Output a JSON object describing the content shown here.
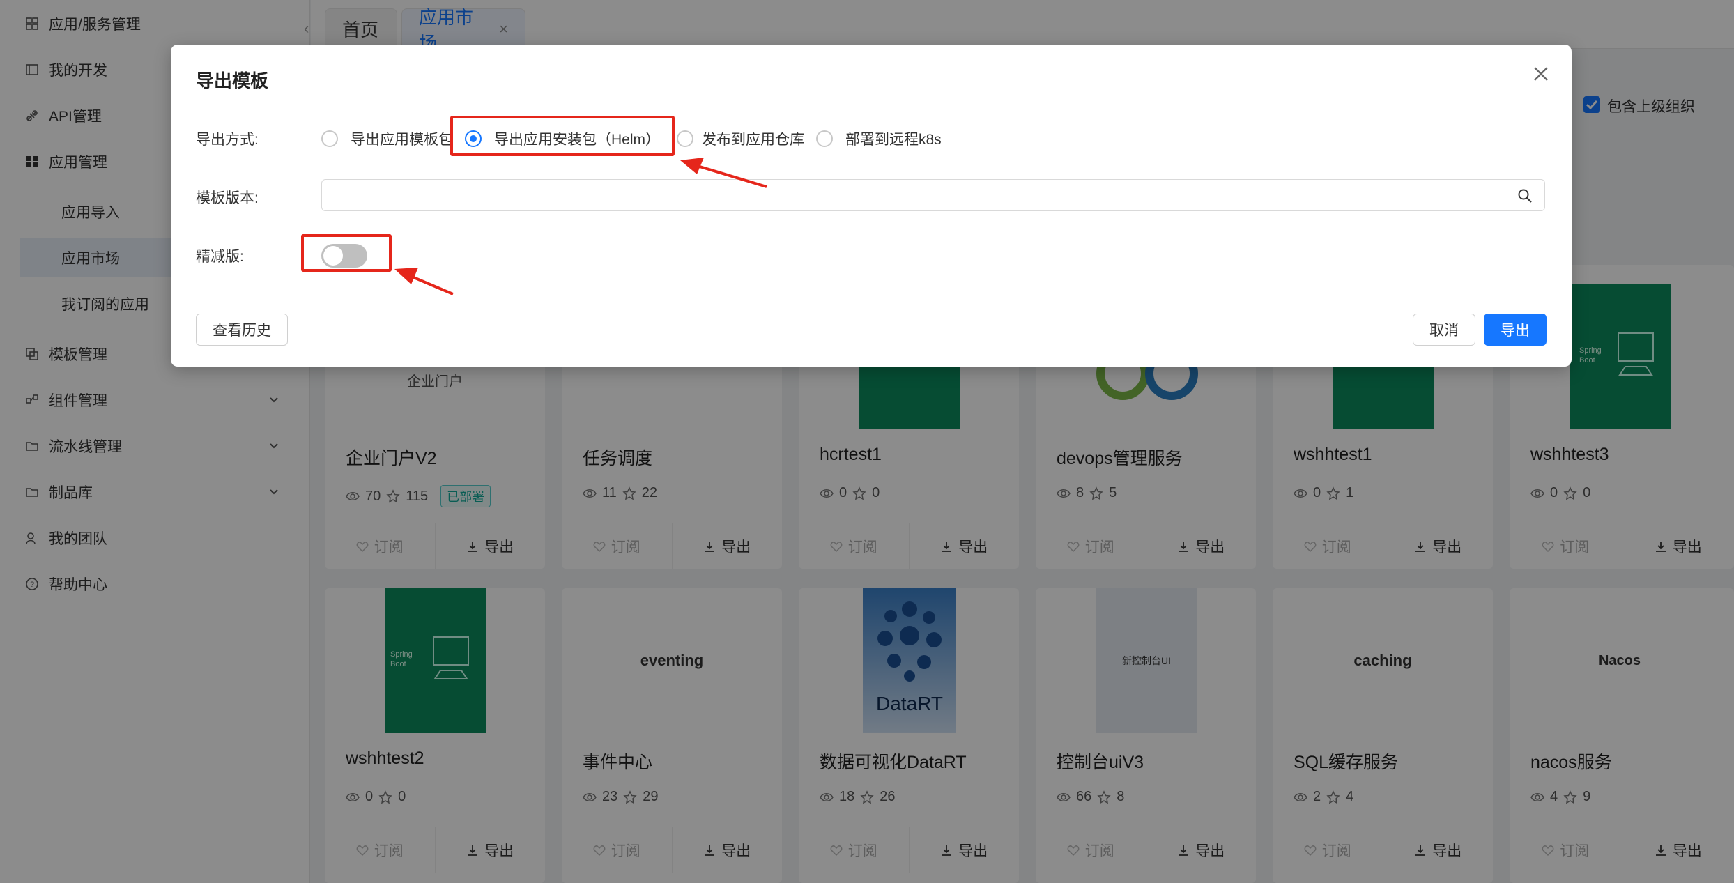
{
  "sidebar": {
    "items": [
      {
        "label": "应用/服务管理",
        "icon": "app-service-icon"
      },
      {
        "label": "我的开发",
        "icon": "develop-icon"
      },
      {
        "label": "API管理",
        "icon": "api-icon"
      },
      {
        "label": "应用管理",
        "icon": "grid-icon"
      },
      {
        "label": "应用导入"
      },
      {
        "label": "应用市场"
      },
      {
        "label": "我订阅的应用"
      },
      {
        "label": "模板管理",
        "icon": "template-icon"
      },
      {
        "label": "组件管理",
        "icon": "component-icon"
      },
      {
        "label": "流水线管理",
        "icon": "folder-icon"
      },
      {
        "label": "制品库",
        "icon": "folder-icon"
      },
      {
        "label": "我的团队",
        "icon": "team-icon"
      },
      {
        "label": "帮助中心",
        "icon": "help-icon"
      }
    ]
  },
  "tabs": [
    {
      "label": "首页"
    },
    {
      "label": "应用市场",
      "close": "×"
    }
  ],
  "filter": {
    "include_parent_org": "包含上级组织"
  },
  "cards": [
    {
      "title": "企业门户V2",
      "thumb_text": "企业门户",
      "views": "70",
      "stars": "115",
      "badge": "已部署"
    },
    {
      "title": "任务调度",
      "views": "11",
      "stars": "22"
    },
    {
      "title": "hcrtest1",
      "views": "0",
      "stars": "0"
    },
    {
      "title": "devops管理服务",
      "views": "8",
      "stars": "5"
    },
    {
      "title": "wshhtest1",
      "views": "0",
      "stars": "1"
    },
    {
      "title": "wshhtest3",
      "views": "0",
      "stars": "0"
    },
    {
      "title": "wshhtest2",
      "views": "0",
      "stars": "0"
    },
    {
      "title": "事件中心",
      "thumb_text": "eventing",
      "views": "23",
      "stars": "29"
    },
    {
      "title": "数据可视化DataRT",
      "thumb_text": "DataRT",
      "views": "18",
      "stars": "26"
    },
    {
      "title": "控制台uiV3",
      "thumb_text": "新控制台UI",
      "views": "66",
      "stars": "8"
    },
    {
      "title": "SQL缓存服务",
      "thumb_text": "caching",
      "views": "2",
      "stars": "4"
    },
    {
      "title": "nacos服务",
      "thumb_text": "Nacos",
      "views": "4",
      "stars": "9"
    }
  ],
  "card_actions": {
    "subscribe": "订阅",
    "export": "导出"
  },
  "spring_logo": {
    "line1": "Spring",
    "line2": "Boot"
  },
  "modal": {
    "title": "导出模板",
    "export_mode_label": "导出方式:",
    "options": [
      {
        "label": "导出应用模板包",
        "checked": false
      },
      {
        "label": "导出应用安装包（Helm）",
        "checked": true
      },
      {
        "label": "发布到应用仓库",
        "checked": false
      },
      {
        "label": "部署到远程k8s",
        "checked": false
      }
    ],
    "version_label": "模板版本:",
    "version_value": "",
    "lite_label": "精减版:",
    "lite_enabled": false,
    "history_button": "查看历史",
    "cancel_button": "取消",
    "export_button": "导出"
  },
  "colors": {
    "primary": "#1677ff",
    "highlight": "#e5261b",
    "spring_green": "#0c8a5d"
  }
}
